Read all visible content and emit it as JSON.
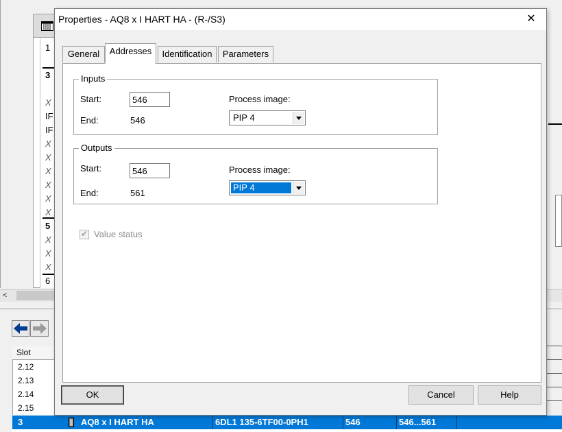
{
  "dialog": {
    "title": "Properties - AQ8 x I HART HA - (R-/S3)",
    "close_glyph": "✕",
    "tabs": [
      {
        "label": "General",
        "active": false
      },
      {
        "label": "Addresses",
        "active": true
      },
      {
        "label": "Identification",
        "active": false
      },
      {
        "label": "Parameters",
        "active": false
      }
    ],
    "inputs": {
      "group_label": "Inputs",
      "start_label": "Start:",
      "start_value": "546",
      "end_label": "End:",
      "end_value": "546",
      "process_image_label": "Process image:",
      "process_image_value": "PIP 4"
    },
    "outputs": {
      "group_label": "Outputs",
      "start_label": "Start:",
      "start_value": "546",
      "end_label": "End:",
      "end_value": "561",
      "process_image_label": "Process image:",
      "process_image_value": "PIP 4"
    },
    "value_status": {
      "label": "Value status",
      "checked": true,
      "enabled": false
    },
    "buttons": {
      "ok": "OK",
      "cancel": "Cancel",
      "help": "Help"
    }
  },
  "background": {
    "table_rows": [
      {
        "text": "1",
        "style": "normal"
      },
      {
        "text": "3",
        "style": "bold"
      },
      {
        "text": "X",
        "style": "italic"
      },
      {
        "text": "IF",
        "style": "normal"
      },
      {
        "text": "IF",
        "style": "normal"
      },
      {
        "text": "X",
        "style": "italic"
      },
      {
        "text": "X",
        "style": "italic"
      },
      {
        "text": "X",
        "style": "italic"
      },
      {
        "text": "X",
        "style": "italic"
      },
      {
        "text": "X",
        "style": "italic"
      },
      {
        "text": "X",
        "style": "italic"
      },
      {
        "text": "5",
        "style": "bold"
      },
      {
        "text": "X",
        "style": "italic"
      },
      {
        "text": "X",
        "style": "italic"
      },
      {
        "text": "X",
        "style": "italic"
      },
      {
        "text": "6",
        "style": "normal"
      }
    ],
    "scroll_left_glyph": "<",
    "slot_header": "Slot",
    "slots": [
      "2.12",
      "2.13",
      "2.14",
      "2.15"
    ],
    "selected_row": {
      "slot": "3",
      "module": "AQ8 x I HART HA",
      "order_number": "6DL1 135-6TF00-0PH1",
      "address": "546",
      "range": "546...561"
    },
    "colors": {
      "selection": "#0078d7",
      "dialog_bg": "#f0f0f0",
      "accent_arrow": "#003c8f"
    }
  }
}
